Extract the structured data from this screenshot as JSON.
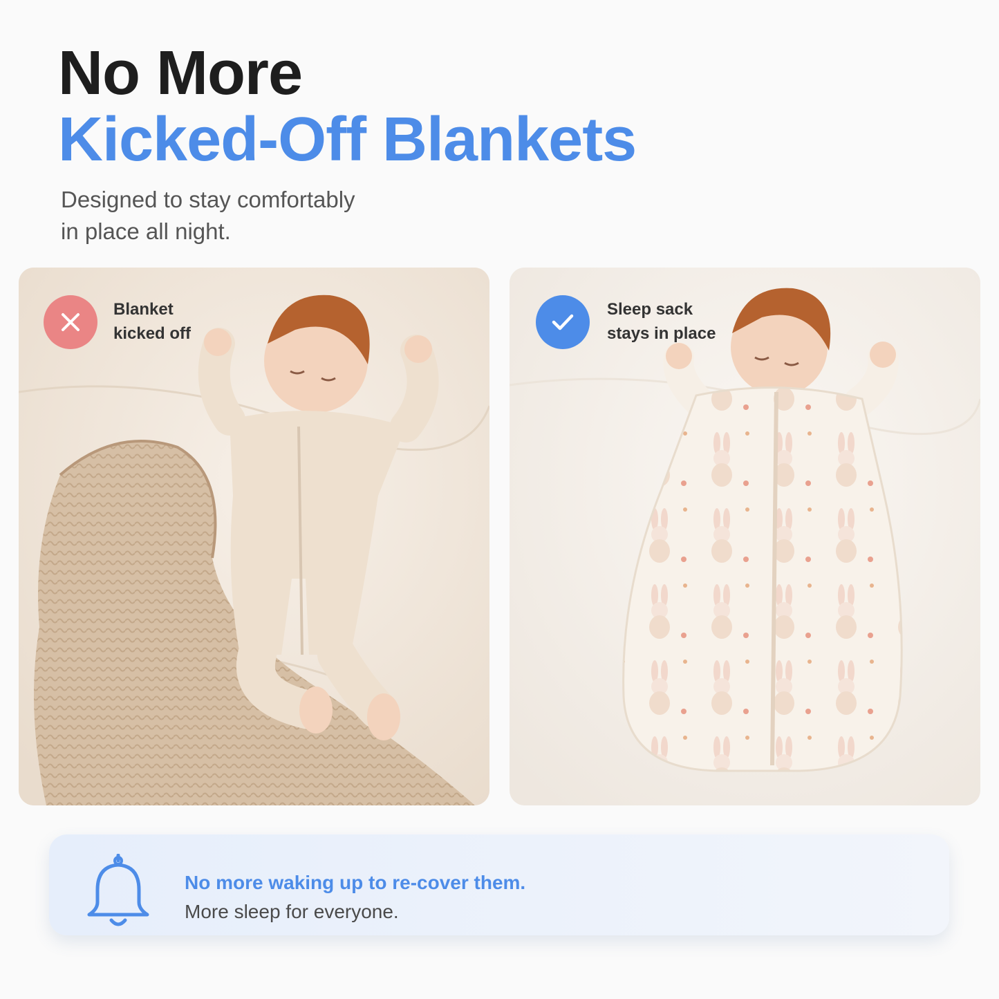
{
  "headline": {
    "line1": "No More",
    "line2": "Kicked-Off Blankets"
  },
  "subheadline": {
    "line1": "Designed to stay comfortably",
    "line2": "in place all night."
  },
  "comparison": {
    "left": {
      "status": "bad",
      "icon": "x-icon",
      "label_line1": "Blanket",
      "label_line2": "kicked off"
    },
    "right": {
      "status": "good",
      "icon": "checkmark-icon",
      "label_line1": "Sleep sack",
      "label_line2": "stays in place"
    }
  },
  "callout": {
    "icon": "bell-icon",
    "title": "No more waking up to re-cover them.",
    "body": "More sleep for everyone."
  },
  "colors": {
    "accent_blue": "#4d8ce8",
    "error_red": "#ea8585",
    "heading_dark": "#1e1e1e",
    "body_gray": "#555555"
  }
}
